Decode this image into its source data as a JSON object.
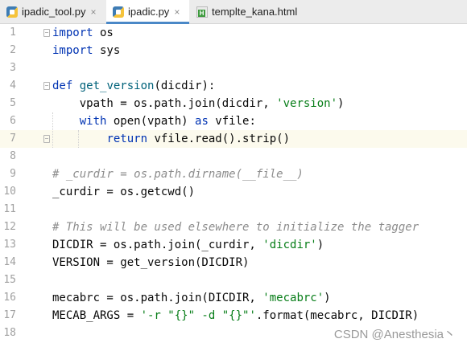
{
  "tabs": [
    {
      "label": "ipadic_tool.py",
      "icon": "python-file-icon",
      "active": false,
      "close": "×"
    },
    {
      "label": "ipadic.py",
      "icon": "python-file-icon",
      "active": true,
      "close": "×"
    },
    {
      "label": "templte_kana.html",
      "icon": "html-file-icon",
      "active": false,
      "close": ""
    }
  ],
  "html_icon_letter": "H",
  "line_numbers": [
    "1",
    "2",
    "3",
    "4",
    "5",
    "6",
    "7",
    "8",
    "9",
    "10",
    "11",
    "12",
    "13",
    "14",
    "15",
    "16",
    "17",
    "18"
  ],
  "current_line": 7,
  "code": {
    "l1": [
      {
        "t": "import",
        "c": "kw"
      },
      {
        "t": " os",
        "c": ""
      }
    ],
    "l2": [
      {
        "t": "import",
        "c": "kw"
      },
      {
        "t": " sys",
        "c": ""
      }
    ],
    "l3": [],
    "l4": [
      {
        "t": "def",
        "c": "kw"
      },
      {
        "t": " ",
        "c": ""
      },
      {
        "t": "get_version",
        "c": "fn"
      },
      {
        "t": "(dicdir):",
        "c": ""
      }
    ],
    "l5": [
      {
        "t": "    vpath = os.path.join(dicdir, ",
        "c": ""
      },
      {
        "t": "'version'",
        "c": "str"
      },
      {
        "t": ")",
        "c": ""
      }
    ],
    "l6": [
      {
        "t": "    ",
        "c": ""
      },
      {
        "t": "with",
        "c": "kw"
      },
      {
        "t": " open(vpath) ",
        "c": ""
      },
      {
        "t": "as",
        "c": "kw"
      },
      {
        "t": " vfile:",
        "c": ""
      }
    ],
    "l7": [
      {
        "t": "        ",
        "c": ""
      },
      {
        "t": "return",
        "c": "kw"
      },
      {
        "t": " vfile.read().strip()",
        "c": ""
      }
    ],
    "l8": [],
    "l9": [
      {
        "t": "# _curdir = os.path.dirname(__file__)",
        "c": "cm"
      }
    ],
    "l10": [
      {
        "t": "_curdir = os.getcwd()",
        "c": ""
      }
    ],
    "l11": [],
    "l12": [
      {
        "t": "# This will be used elsewhere to initialize the tagger",
        "c": "cm"
      }
    ],
    "l13": [
      {
        "t": "DICDIR = os.path.join(_curdir, ",
        "c": ""
      },
      {
        "t": "'dicdir'",
        "c": "str"
      },
      {
        "t": ")",
        "c": ""
      }
    ],
    "l14": [
      {
        "t": "VERSION = get_version(DICDIR)",
        "c": ""
      }
    ],
    "l15": [],
    "l16": [
      {
        "t": "mecabrc = os.path.join(DICDIR, ",
        "c": ""
      },
      {
        "t": "'mecabrc'",
        "c": "str"
      },
      {
        "t": ")",
        "c": ""
      }
    ],
    "l17": [
      {
        "t": "MECAB_ARGS = ",
        "c": ""
      },
      {
        "t": "'-r \"{}\" -d \"{}\"'",
        "c": "str"
      },
      {
        "t": ".format(mecabrc, DICDIR)",
        "c": ""
      }
    ],
    "l18": []
  },
  "watermark": "CSDN @Anesthesia丶"
}
